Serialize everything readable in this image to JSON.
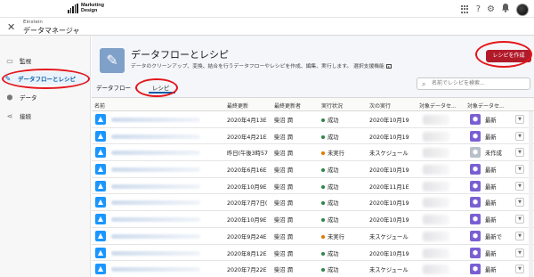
{
  "brand": {
    "line1": "Marketing",
    "line2": "Design"
  },
  "header_icons": [
    "apps-grid-icon",
    "help-icon",
    "gear-icon",
    "bell-icon",
    "avatar"
  ],
  "app": {
    "small_title": "Einstein",
    "title": "データマネージャ"
  },
  "sidebar": {
    "items": [
      {
        "label": "監視",
        "icon": "monitor-icon"
      },
      {
        "label": "データフローとレシピ",
        "icon": "pencil-icon"
      },
      {
        "label": "データ",
        "icon": "hexagon-icon"
      },
      {
        "label": "接続",
        "icon": "share-icon"
      }
    ]
  },
  "page": {
    "title": "データフローとレシピ",
    "description": "データのクリーンアップ、変換、結合を行うデータフローやレシピを作成、編集、実行します。 選択支援機能",
    "create_button": "レシピを作成",
    "tabs": [
      "データフロー",
      "レシピ"
    ],
    "search_placeholder": "名前でレシピを検索..."
  },
  "colors": {
    "accent": "#0b5cab",
    "create_button": "#b11a29",
    "success": "#2e844a",
    "not_run": "#dd7a01",
    "highlight": "#e4151b"
  },
  "table": {
    "headers": [
      "名前",
      "最終更新",
      "最終更新者",
      "実行状況",
      "次の実行",
      "対象データセ...",
      "対象データセ..."
    ],
    "rows": [
      {
        "updated": "2020年4月13E",
        "by": "柴沼 潤",
        "status": "成功",
        "status_type": "success",
        "next": "2020年10月19",
        "ds": "最新",
        "ds_type": "normal"
      },
      {
        "updated": "2020年4月21E",
        "by": "柴沼 潤",
        "status": "成功",
        "status_type": "success",
        "next": "2020年10月19",
        "ds": "最新",
        "ds_type": "normal"
      },
      {
        "updated": "昨日(午後3時57",
        "by": "柴沼 潤",
        "status": "未実行",
        "status_type": "warning",
        "next": "未スケジュール",
        "ds": "未作成",
        "ds_type": "gray"
      },
      {
        "updated": "2020年6月16E",
        "by": "柴沼 潤",
        "status": "成功",
        "status_type": "success",
        "next": "2020年10月19",
        "ds": "最新",
        "ds_type": "normal"
      },
      {
        "updated": "2020年10月9E",
        "by": "柴沼 潤",
        "status": "成功",
        "status_type": "success",
        "next": "2020年11月1E",
        "ds": "最新",
        "ds_type": "normal"
      },
      {
        "updated": "2020年7月7日(",
        "by": "柴沼 潤",
        "status": "成功",
        "status_type": "success",
        "next": "2020年10月19",
        "ds": "最新",
        "ds_type": "normal"
      },
      {
        "updated": "2020年10月9E",
        "by": "柴沼 潤",
        "status": "成功",
        "status_type": "success",
        "next": "2020年10月19",
        "ds": "最新",
        "ds_type": "normal"
      },
      {
        "updated": "2020年9月24E",
        "by": "柴沼 潤",
        "status": "未実行",
        "status_type": "warning",
        "next": "未スケジュール",
        "ds": "最新で",
        "ds_type": "normal"
      },
      {
        "updated": "2020年8月12E",
        "by": "柴沼 潤",
        "status": "成功",
        "status_type": "success",
        "next": "2020年10月19",
        "ds": "最新",
        "ds_type": "normal"
      },
      {
        "updated": "2020年7月22E",
        "by": "柴沼 潤",
        "status": "成功",
        "status_type": "success",
        "next": "未スケジュール",
        "ds": "最新",
        "ds_type": "normal"
      }
    ]
  }
}
